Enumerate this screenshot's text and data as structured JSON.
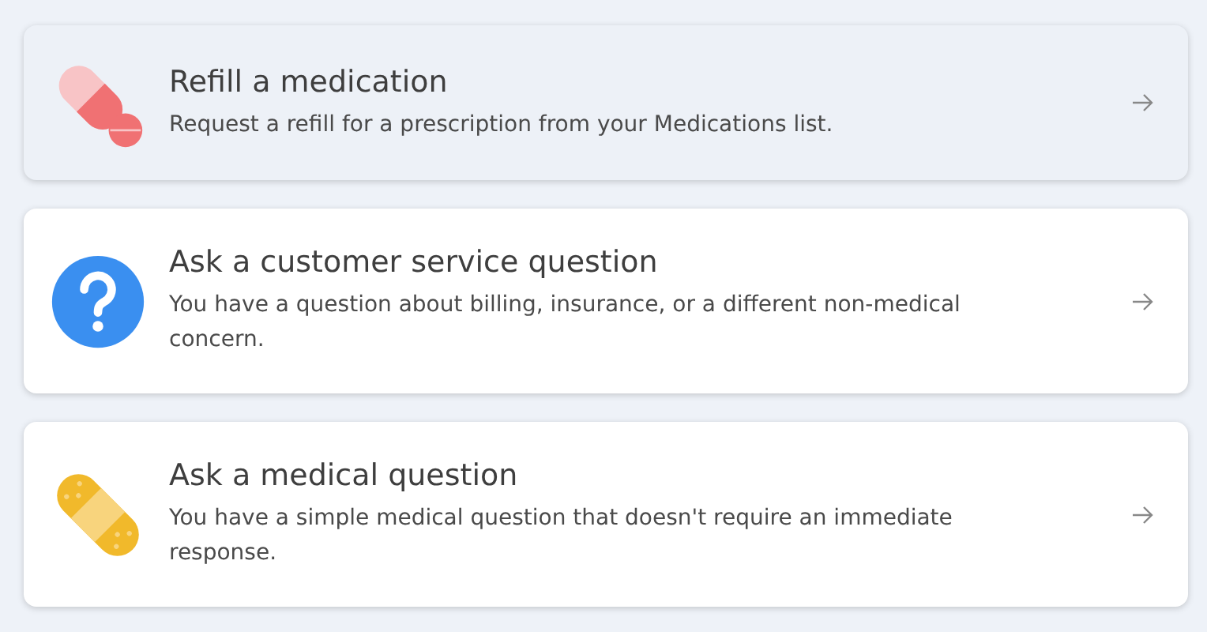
{
  "options": [
    {
      "kind": "pill",
      "title": "Refill a medication",
      "description": "Request a refill for a prescription from your Medications list.",
      "selected": true
    },
    {
      "kind": "question",
      "title": "Ask a customer service question",
      "description": "You have a question about billing, insurance, or a different non-medical concern.",
      "selected": false
    },
    {
      "kind": "bandage",
      "title": "Ask a medical question",
      "description": "You have a simple medical question that doesn't require an immediate response.",
      "selected": false
    }
  ]
}
